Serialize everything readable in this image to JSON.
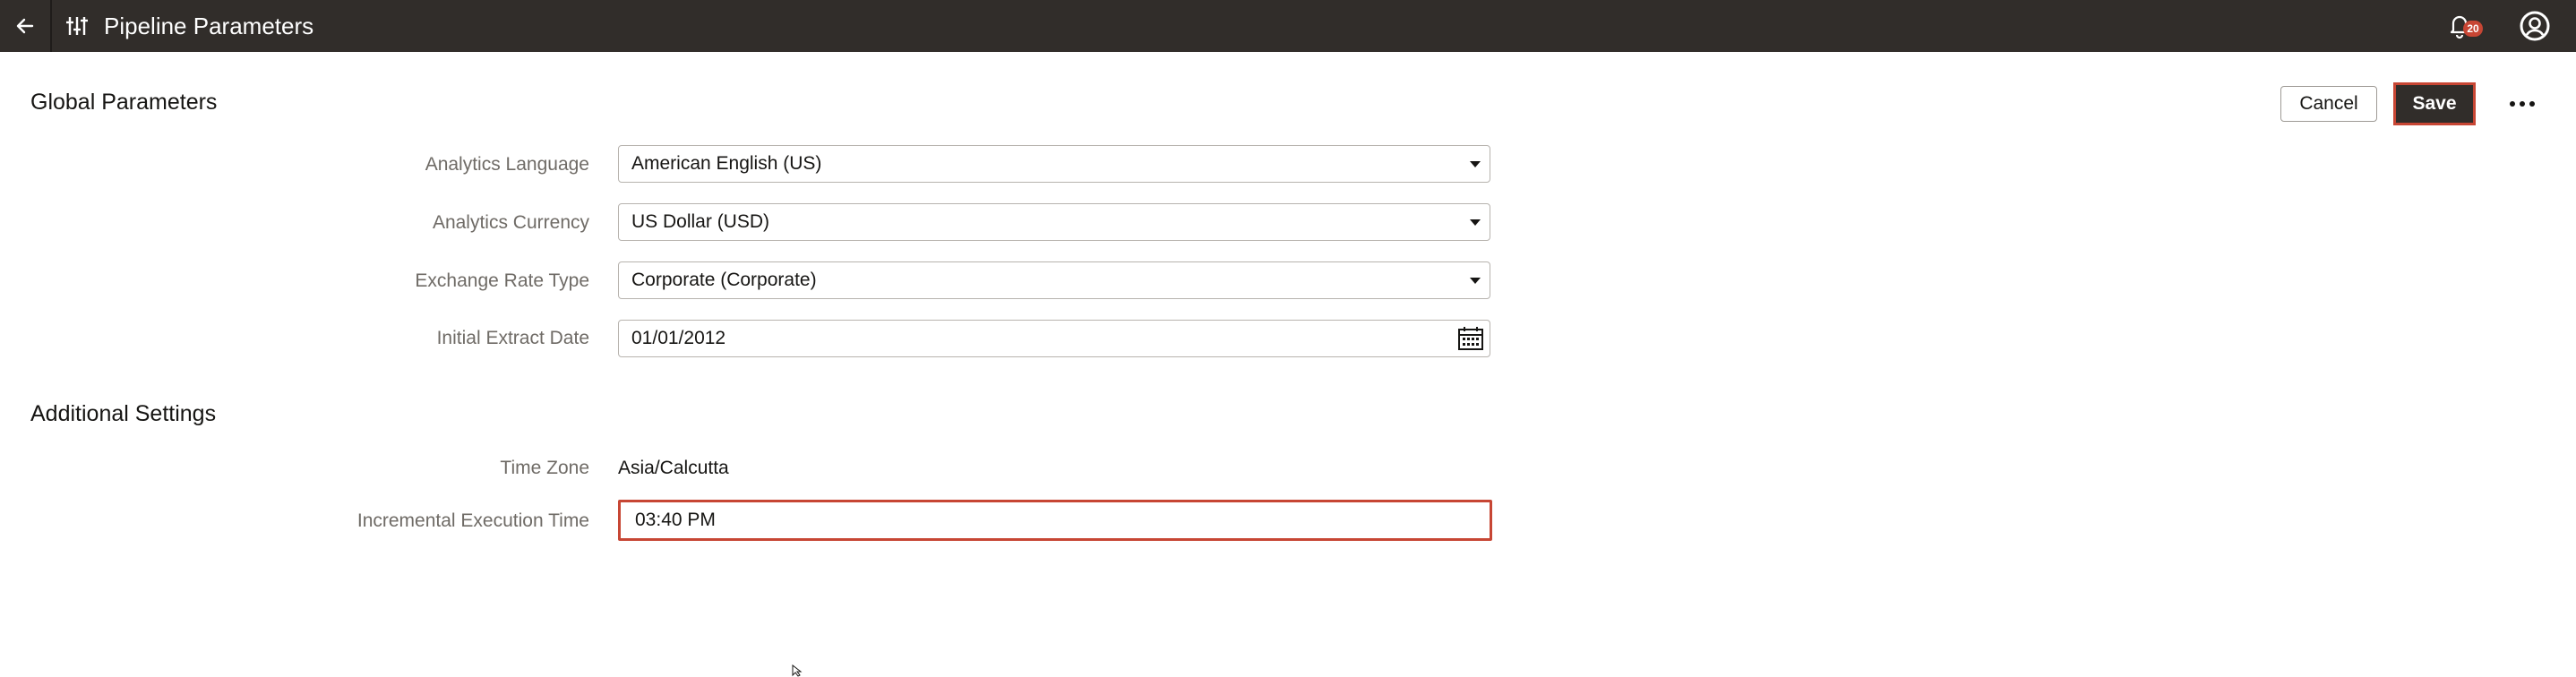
{
  "header": {
    "title": "Pipeline Parameters",
    "back_icon": "arrow-left-icon",
    "page_icon": "sliders-icon",
    "notification_icon": "bell-icon",
    "notification_count": "20",
    "user_icon": "user-circle-icon"
  },
  "actions": {
    "cancel_label": "Cancel",
    "save_label": "Save",
    "more_icon": "ellipsis-icon"
  },
  "global_parameters": {
    "title": "Global Parameters",
    "fields": {
      "language": {
        "label": "Analytics Language",
        "value": "American English (US)"
      },
      "currency": {
        "label": "Analytics Currency",
        "value": "US Dollar (USD)"
      },
      "exchange_rate": {
        "label": "Exchange Rate Type",
        "value": "Corporate (Corporate)"
      },
      "extract_date": {
        "label": "Initial Extract Date",
        "value": "01/01/2012"
      }
    }
  },
  "additional_settings": {
    "title": "Additional Settings",
    "fields": {
      "time_zone": {
        "label": "Time Zone",
        "value": "Asia/Calcutta"
      },
      "execution_time": {
        "label": "Incremental Execution Time",
        "value": "03:40 PM"
      }
    }
  },
  "colors": {
    "header_bg": "#312d2a",
    "accent_red": "#c74634",
    "label_gray": "#6f6b66"
  }
}
